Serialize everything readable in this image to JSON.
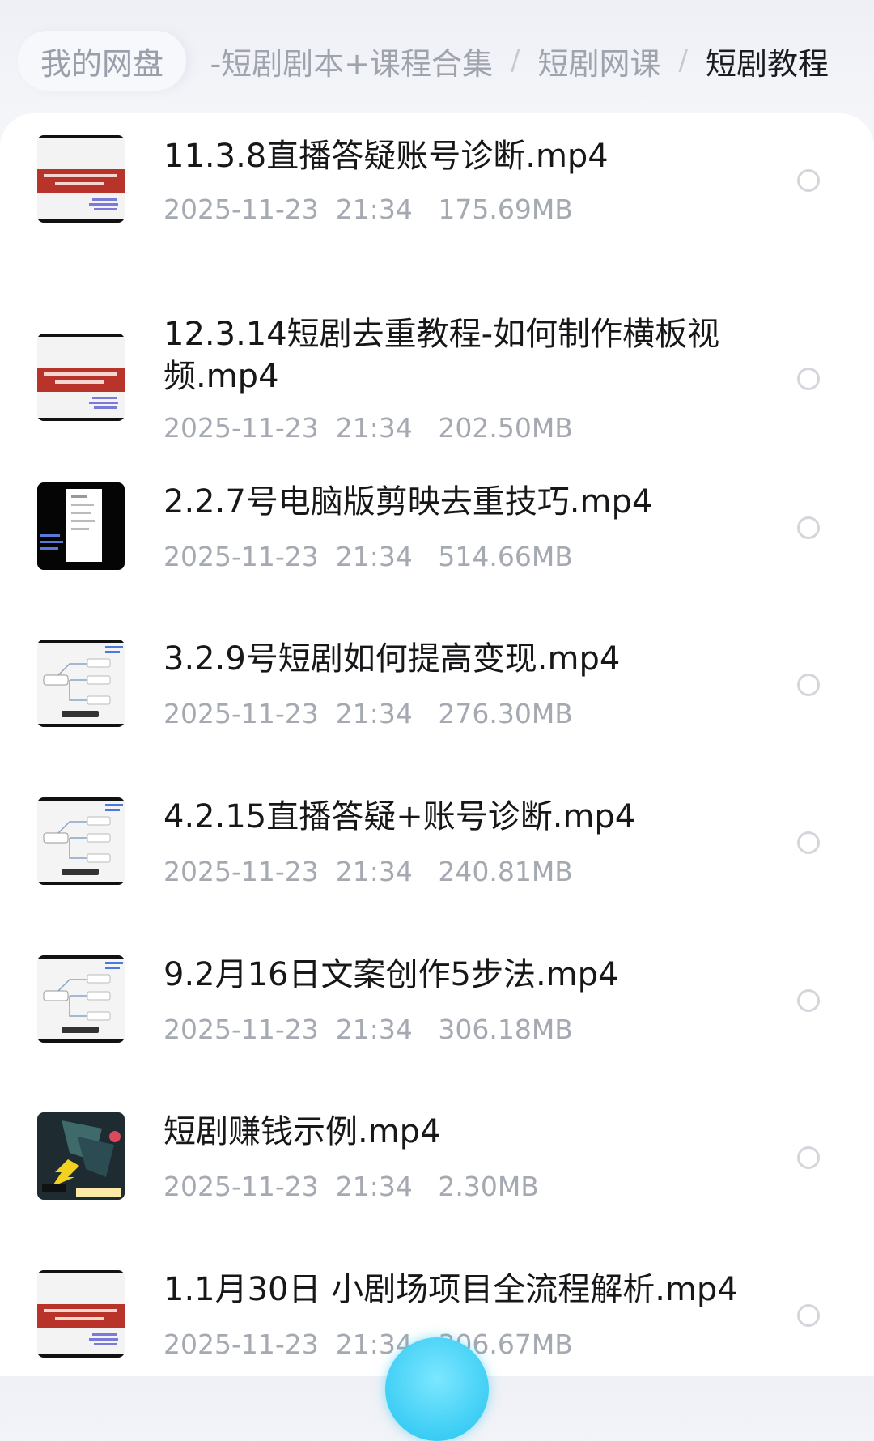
{
  "breadcrumb": {
    "root": "我的网盘",
    "items": [
      {
        "label": "-短剧剧本+课程合集",
        "current": false
      },
      {
        "label": "短剧网课",
        "current": false
      },
      {
        "label": "短剧教程",
        "current": true
      }
    ],
    "separator": "/"
  },
  "files": [
    {
      "name": "11.3.8直播答疑账号诊断.mp4",
      "date": "2025-11-23",
      "time": "21:34",
      "size": "175.69MB",
      "thumb_icon": "video-thumbnail-red-title-slide"
    },
    {
      "name": "12.3.14短剧去重教程-如何制作横板视频.mp4",
      "date": "2025-11-23",
      "time": "21:34",
      "size": "202.50MB",
      "thumb_icon": "video-thumbnail-red-title-slide"
    },
    {
      "name": "2.2.7号电脑版剪映去重技巧.mp4",
      "date": "2025-11-23",
      "time": "21:34",
      "size": "514.66MB",
      "thumb_icon": "video-thumbnail-dark-screen"
    },
    {
      "name": "3.2.9号短剧如何提高变现.mp4",
      "date": "2025-11-23",
      "time": "21:34",
      "size": "276.30MB",
      "thumb_icon": "video-thumbnail-mindmap"
    },
    {
      "name": "4.2.15直播答疑+账号诊断.mp4",
      "date": "2025-11-23",
      "time": "21:34",
      "size": "240.81MB",
      "thumb_icon": "video-thumbnail-mindmap"
    },
    {
      "name": "9.2月16日文案创作5步法.mp4",
      "date": "2025-11-23",
      "time": "21:34",
      "size": "306.18MB",
      "thumb_icon": "video-thumbnail-mindmap"
    },
    {
      "name": "短剧赚钱示例.mp4",
      "date": "2025-11-23",
      "time": "21:34",
      "size": "2.30MB",
      "thumb_icon": "video-thumbnail-drama-clip"
    },
    {
      "name": "1.1月30日 小剧场项目全流程解析.mp4",
      "date": "2025-11-23",
      "time": "21:34",
      "size": "306.67MB",
      "thumb_icon": "video-thumbnail-red-title-slide"
    }
  ],
  "colors": {
    "text_primary": "#17171a",
    "text_secondary": "#a5a9b1",
    "breadcrumb_inactive": "#9ea3ad",
    "accent_fab": "#22c3f0",
    "thumb_red": "#b8342a"
  }
}
